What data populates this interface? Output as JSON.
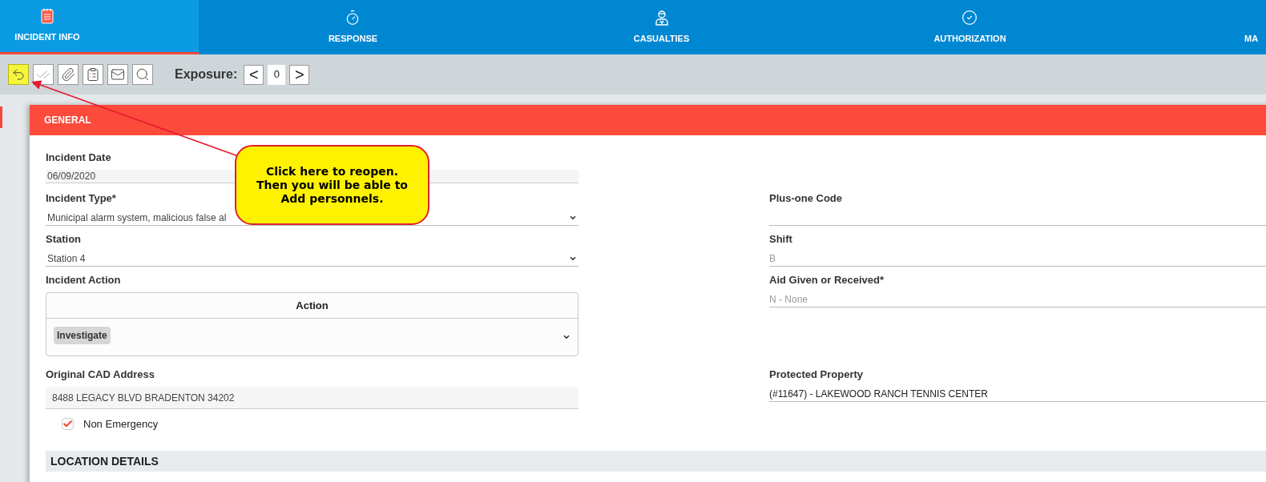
{
  "tabs": [
    {
      "label": "INCIDENT INFO",
      "selected": true
    },
    {
      "label": "RESPONSE",
      "selected": false
    },
    {
      "label": "CASUALTIES",
      "selected": false
    },
    {
      "label": "AUTHORIZATION",
      "selected": false
    },
    {
      "label": "MA",
      "selected": false
    }
  ],
  "toolbar": {
    "buttons": [
      {
        "highlighted": true
      },
      {
        "highlighted": false
      },
      {
        "highlighted": false
      },
      {
        "highlighted": false
      },
      {
        "highlighted": false
      },
      {
        "highlighted": false
      }
    ],
    "exposure": {
      "label": "Exposure:",
      "prev": "<",
      "value": "0",
      "next": ">"
    }
  },
  "section": {
    "title": "GENERAL",
    "rows": [
      {
        "left": {
          "kind": "filled",
          "label": "Incident Date",
          "value": "06/09/2020"
        }
      },
      {
        "left": {
          "kind": "select",
          "label": "Incident Type*",
          "value": "Municipal alarm system, malicious false al"
        },
        "right": {
          "kind": "line",
          "label": "Plus-one Code"
        }
      },
      {
        "left": {
          "kind": "select",
          "label": "Station",
          "value": "Station 4"
        },
        "right": {
          "kind": "line",
          "label": "Shift",
          "value": "B",
          "disabled": true
        }
      },
      {
        "left": {
          "kind": "table",
          "label": "Incident Action",
          "header": "Action",
          "chips": [
            "Investigate"
          ]
        },
        "right": {
          "kind": "line",
          "label": "Aid Given or Received*",
          "value": "N - None",
          "disabled": true
        }
      },
      {
        "left": {
          "kind": "filled",
          "label": "Original CAD Address",
          "value": "8488 LEGACY BLVD BRADENTON 34202"
        },
        "right": {
          "kind": "line",
          "label": "Protected Property",
          "value": "(#11647) -  LAKEWOOD RANCH TENNIS CENTER",
          "disabled": false
        }
      },
      {
        "left": {
          "kind": "checkbox",
          "label": "Non Emergency",
          "checked": true
        }
      }
    ]
  },
  "next_section": {
    "title": "LOCATION DETAILS"
  },
  "callout": {
    "lines": [
      "Click here to reopen.",
      "Then you will be able to",
      "Add personnels."
    ]
  }
}
